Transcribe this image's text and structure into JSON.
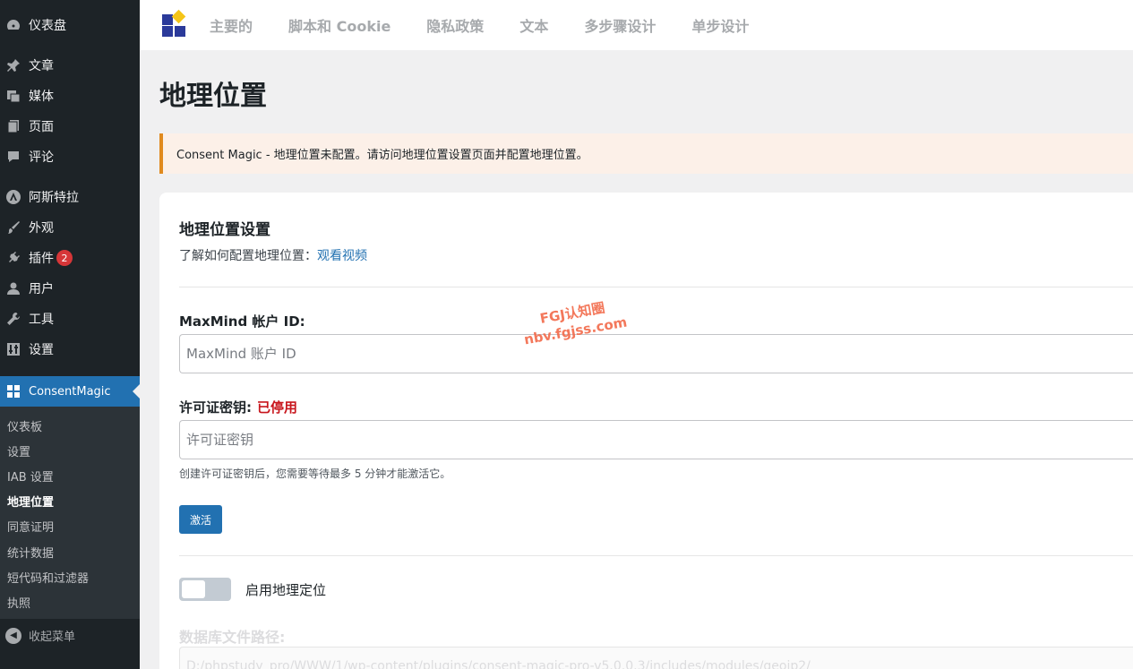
{
  "sidebar": {
    "dashboard": "仪表盘",
    "posts": "文章",
    "media": "媒体",
    "pages": "页面",
    "comments": "评论",
    "astra": "阿斯特拉",
    "appearance": "外观",
    "plugins": "插件",
    "plugins_badge": "2",
    "users": "用户",
    "tools": "工具",
    "settings": "设置",
    "consentmagic": "ConsentMagic",
    "submenu": [
      "仪表板",
      "设置",
      "IAB 设置",
      "地理位置",
      "同意证明",
      "统计数据",
      "短代码和过滤器",
      "执照"
    ],
    "collapse": "收起菜单"
  },
  "topnav": {
    "tabs": [
      "主要的",
      "脚本和 Cookie",
      "隐私政策",
      "文本",
      "多步骤设计",
      "单步设计"
    ]
  },
  "page": {
    "title": "地理位置",
    "notice": "Consent Magic - 地理位置未配置。请访问地理位置设置页面并配置地理位置。"
  },
  "card": {
    "title": "地理位置设置",
    "subtitle_prefix": "了解如何配置地理位置：",
    "subtitle_link": "观看视频",
    "maxmind_label": "MaxMind 帐户 ID:",
    "maxmind_placeholder": "MaxMind 账户 ID",
    "license_label": "许可证密钥:",
    "license_status": "已停用",
    "license_placeholder": "许可证密钥",
    "hint": "创建许可证密钥后，您需要等待最多 5 分钟才能激活它。",
    "activate_button": "激活",
    "toggle_label": "启用地理定位",
    "db_label": "数据库文件路径:",
    "db_path": "D:/phpstudy_pro/WWW/1/wp-content/plugins/consent-magic-pro-v5.0.0.3/includes/modules/geoip2/"
  },
  "watermark": {
    "line1": "FGJ认知圈",
    "line2": "nbv.fgjss.com"
  },
  "colors": {
    "sidebar_bg": "#1d2327",
    "accent": "#2271b1",
    "notice_border": "#e08a1e",
    "status_red": "#c8161d"
  }
}
